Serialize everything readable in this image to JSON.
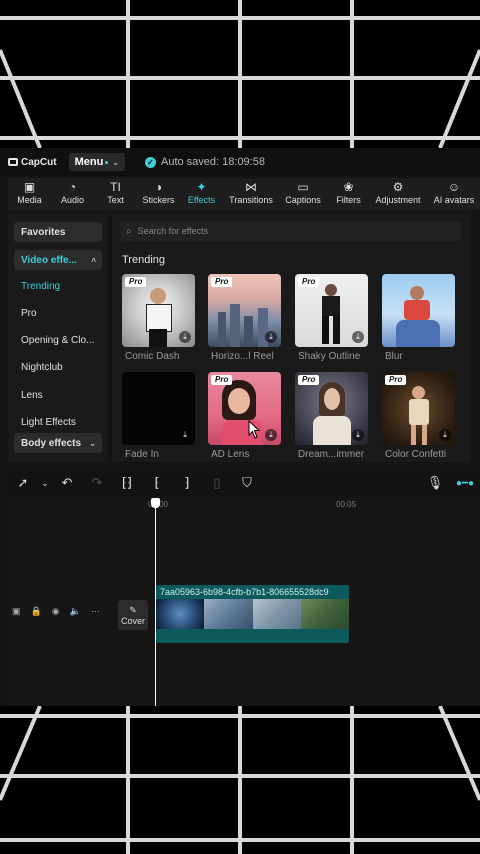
{
  "topbar": {
    "logo_text": "CapCut",
    "menu_label": "Menu",
    "autosave_text": "Auto saved: 18:09:58"
  },
  "toolbar": {
    "items": [
      {
        "label": "Media",
        "icon": "media-icon"
      },
      {
        "label": "Audio",
        "icon": "audio-icon"
      },
      {
        "label": "Text",
        "icon": "text-icon",
        "glyph": "TI"
      },
      {
        "label": "Stickers",
        "icon": "stickers-icon"
      },
      {
        "label": "Effects",
        "icon": "effects-icon",
        "active": true
      },
      {
        "label": "Transitions",
        "icon": "transitions-icon"
      },
      {
        "label": "Captions",
        "icon": "captions-icon"
      },
      {
        "label": "Filters",
        "icon": "filters-icon"
      },
      {
        "label": "Adjustment",
        "icon": "adjustment-icon"
      },
      {
        "label": "AI avatars",
        "icon": "ai-avatars-icon"
      }
    ]
  },
  "sidebar": {
    "favorites": "Favorites",
    "video_effects": "Video effe...",
    "items": [
      "Trending",
      "Pro",
      "Opening & Clo...",
      "Nightclub",
      "Lens",
      "Light Effects"
    ],
    "body_effects": "Body effects"
  },
  "content": {
    "search_placeholder": "Search for effects",
    "section_title": "Trending",
    "pro_badge": "Pro",
    "cards": [
      {
        "label": "Comic Dash",
        "pro": true
      },
      {
        "label": "Horizo...l Reel",
        "pro": true
      },
      {
        "label": "Shaky Outline",
        "pro": true
      },
      {
        "label": "Blur",
        "pro": false
      },
      {
        "label": "Fade In",
        "pro": false
      },
      {
        "label": "AD Lens",
        "pro": true
      },
      {
        "label": "Dream...immer",
        "pro": true
      },
      {
        "label": "Color Confetti",
        "pro": true
      }
    ]
  },
  "timeline": {
    "ruler_start": "00:00",
    "ruler_mark": "00:05",
    "cover_label": "Cover",
    "clip_name": "7aa05963-6b98-4cfb-b7b1-806655528dc9"
  },
  "colors": {
    "accent": "#3bd1d9",
    "clip": "#0c5a5c"
  }
}
